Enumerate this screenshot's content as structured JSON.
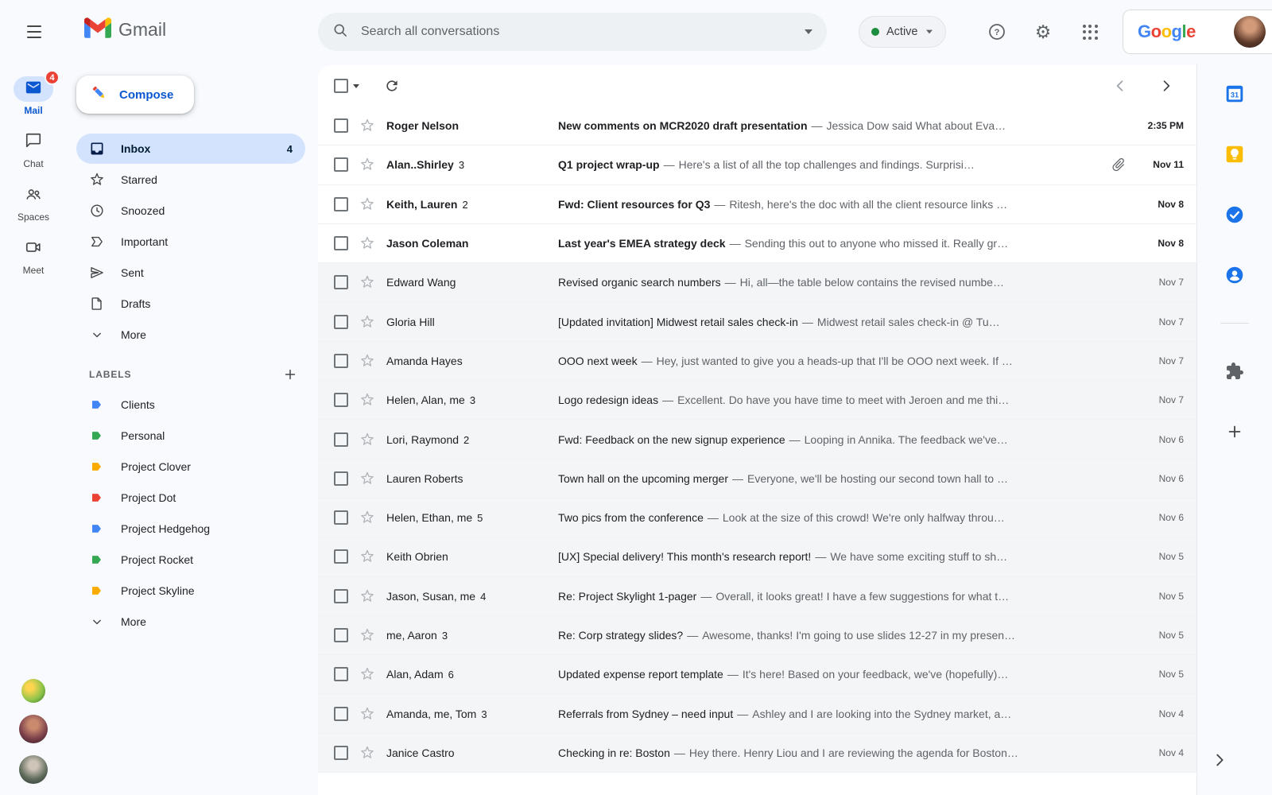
{
  "header": {
    "brand": "Gmail",
    "search_placeholder": "Search all conversations",
    "status_label": "Active",
    "google_logo": "Google"
  },
  "rail": {
    "items": [
      {
        "label": "Mail",
        "badge": "4",
        "selected": true
      },
      {
        "label": "Chat"
      },
      {
        "label": "Spaces"
      },
      {
        "label": "Meet"
      }
    ]
  },
  "sidebar": {
    "compose_label": "Compose",
    "items": [
      {
        "label": "Inbox",
        "count": "4",
        "selected": true
      },
      {
        "label": "Starred"
      },
      {
        "label": "Snoozed"
      },
      {
        "label": "Important"
      },
      {
        "label": "Sent"
      },
      {
        "label": "Drafts"
      },
      {
        "label": "More"
      }
    ],
    "labels_header": "LABELS",
    "labels": [
      {
        "name": "Clients",
        "color": "#4285f4"
      },
      {
        "name": "Personal",
        "color": "#34a853"
      },
      {
        "name": "Project Clover",
        "color": "#f9ab00"
      },
      {
        "name": "Project Dot",
        "color": "#ea4335"
      },
      {
        "name": "Project Hedgehog",
        "color": "#4285f4"
      },
      {
        "name": "Project Rocket",
        "color": "#34a853"
      },
      {
        "name": "Project Skyline",
        "color": "#f9ab00"
      }
    ],
    "labels_more": "More"
  },
  "list": {
    "separator": "—"
  },
  "emails": [
    {
      "sender": "Roger Nelson",
      "subject": "New comments on MCR2020 draft presentation",
      "snippet": "Jessica Dow said What about Eva…",
      "date": "2:35 PM",
      "unread": true
    },
    {
      "sender": "Alan..Shirley",
      "count": "3",
      "subject": "Q1 project wrap-up",
      "snippet": "Here's a list of all the top challenges and findings. Surprisi…",
      "date": "Nov 11",
      "unread": true,
      "attachment": true
    },
    {
      "sender": "Keith, Lauren",
      "count": "2",
      "subject": "Fwd: Client resources for Q3",
      "snippet": "Ritesh, here's the doc with all the client resource links …",
      "date": "Nov 8",
      "unread": true
    },
    {
      "sender": "Jason Coleman",
      "subject": "Last year's EMEA strategy deck",
      "snippet": "Sending this out to anyone who missed it. Really gr…",
      "date": "Nov 8",
      "unread": true
    },
    {
      "sender": "Edward Wang",
      "subject": "Revised organic search numbers",
      "snippet": "Hi, all—the table below contains the revised numbe…",
      "date": "Nov 7"
    },
    {
      "sender": "Gloria Hill",
      "subject": "[Updated invitation] Midwest retail sales check-in",
      "snippet": "Midwest retail sales check-in @ Tu…",
      "date": "Nov 7"
    },
    {
      "sender": "Amanda Hayes",
      "subject": "OOO next week",
      "snippet": "Hey, just wanted to give you a heads-up that I'll be OOO next week. If …",
      "date": "Nov 7"
    },
    {
      "sender": "Helen, Alan, me",
      "count": "3",
      "subject": "Logo redesign ideas",
      "snippet": "Excellent. Do have you have time to meet with Jeroen and me thi…",
      "date": "Nov 7"
    },
    {
      "sender": "Lori, Raymond",
      "count": "2",
      "subject": "Fwd: Feedback on the new signup experience",
      "snippet": "Looping in Annika. The feedback we've…",
      "date": "Nov 6"
    },
    {
      "sender": "Lauren Roberts",
      "subject": "Town hall on the upcoming merger",
      "snippet": "Everyone, we'll be hosting our second town hall to …",
      "date": "Nov 6"
    },
    {
      "sender": "Helen, Ethan, me",
      "count": "5",
      "subject": "Two pics from the conference",
      "snippet": "Look at the size of this crowd! We're only halfway throu…",
      "date": "Nov 6"
    },
    {
      "sender": "Keith Obrien",
      "subject": "[UX] Special delivery! This month's research report!",
      "snippet": "We have some exciting stuff to sh…",
      "date": "Nov 5"
    },
    {
      "sender": "Jason, Susan, me",
      "count": "4",
      "subject": "Re: Project Skylight 1-pager",
      "snippet": "Overall, it looks great! I have a few suggestions for what t…",
      "date": "Nov 5"
    },
    {
      "sender": "me, Aaron",
      "count": "3",
      "subject": "Re: Corp strategy slides?",
      "snippet": "Awesome, thanks! I'm going to use slides 12-27 in my presen…",
      "date": "Nov 5"
    },
    {
      "sender": "Alan, Adam",
      "count": "6",
      "subject": "Updated expense report template",
      "snippet": "It's here! Based on your feedback, we've (hopefully)…",
      "date": "Nov 5"
    },
    {
      "sender": "Amanda, me, Tom",
      "count": "3",
      "subject": "Referrals from Sydney – need input",
      "snippet": "Ashley and I are looking into the Sydney market, a…",
      "date": "Nov 4"
    },
    {
      "sender": "Janice Castro",
      "subject": "Checking in re: Boston",
      "snippet": "Hey there. Henry Liou and I are reviewing the agenda for Boston…",
      "date": "Nov 4"
    }
  ],
  "side_panel": {
    "calendar_day": "31"
  },
  "colors": {
    "accent": "#0b57d0",
    "selected_bg": "#d3e3fd",
    "unread_text": "#202124",
    "muted_text": "#5f6368",
    "badge_red": "#ea4335",
    "active_green": "#1e8e3e",
    "google_letters": [
      "#4285F4",
      "#EA4335",
      "#FBBC04",
      "#4285F4",
      "#34A853",
      "#EA4335"
    ]
  }
}
